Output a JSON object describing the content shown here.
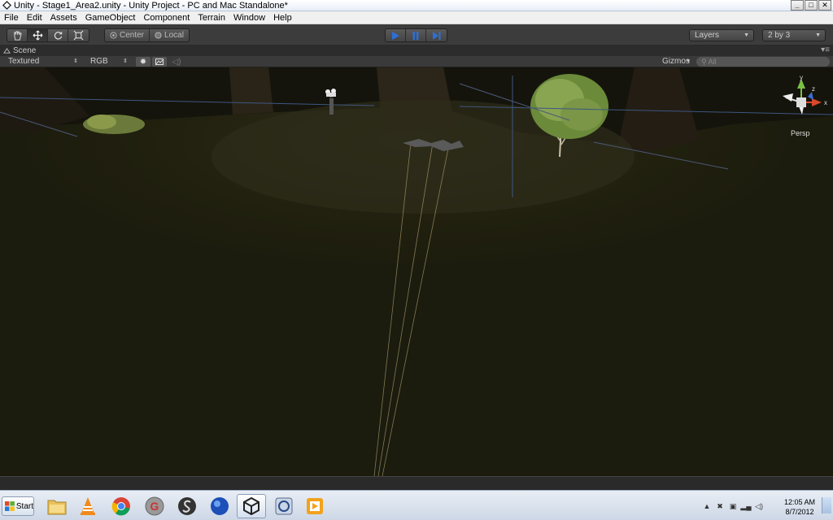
{
  "window": {
    "title": "Unity - Stage1_Area2.unity - Unity Project - PC and Mac Standalone*",
    "controls": {
      "minimize": "_",
      "maximize": "□",
      "close": "✕"
    }
  },
  "menu": [
    "File",
    "Edit",
    "Assets",
    "GameObject",
    "Component",
    "Terrain",
    "Window",
    "Help"
  ],
  "toolbar": {
    "tools": [
      "hand-icon",
      "move-icon",
      "rotate-icon",
      "scale-icon"
    ],
    "active_tool": "move-icon",
    "pivot_center_label": "Center",
    "pivot_local_label": "Local",
    "layers_label": "Layers",
    "layout_label": "2 by 3",
    "play_color": "#2f6fd6"
  },
  "scene": {
    "tab_label": "Scene",
    "render_mode": "Textured",
    "color_mode": "RGB",
    "gizmos_label": "Gizmos",
    "search_placeholder": "All",
    "persp_label": "Persp",
    "gizmo_axes": {
      "y": "y",
      "x": "x",
      "z": "z"
    }
  },
  "taskbar": {
    "start_label": "Start",
    "apps": [
      "folder-icon",
      "vlc-icon",
      "chrome-icon",
      "g-app-icon",
      "s-app-icon",
      "blue-sphere-icon",
      "unity-icon",
      "unity-monodevelop-icon",
      "media-icon"
    ],
    "active_app": "unity-icon",
    "time": "12:05 AM",
    "date": "8/7/2012"
  }
}
